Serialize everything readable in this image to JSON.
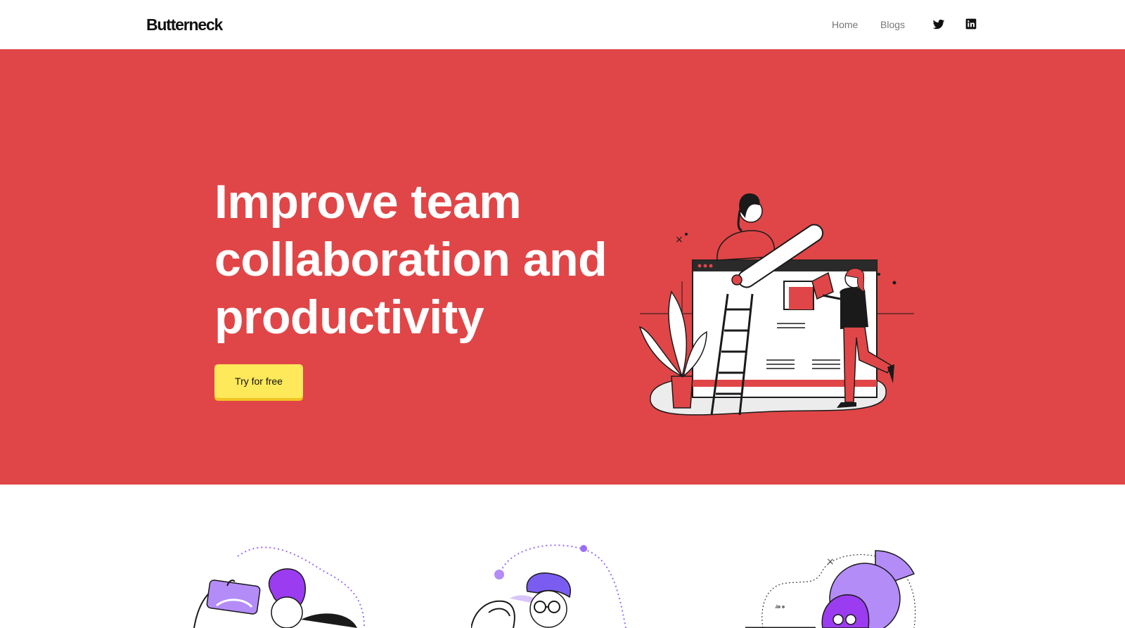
{
  "nav": {
    "logo": "Butterneck",
    "links": [
      {
        "label": "Home"
      },
      {
        "label": "Blogs"
      }
    ],
    "social": [
      "twitter-icon",
      "linkedin-icon"
    ]
  },
  "hero": {
    "title_lines": [
      "Improve team",
      "collaboration and",
      "productivity"
    ],
    "cta_label": "Try for free",
    "illustration": "team-collaboration-illustration"
  },
  "features": {
    "illustrations": [
      "person-with-tablet-illustration",
      "person-with-glasses-illustration",
      "person-with-pie-chart-illustration"
    ]
  },
  "colors": {
    "hero_bg": "#e04647",
    "cta_bg": "#fde95a",
    "accent_purple": "#9b6cf6",
    "text_dark": "#111111",
    "nav_link": "#777777"
  }
}
